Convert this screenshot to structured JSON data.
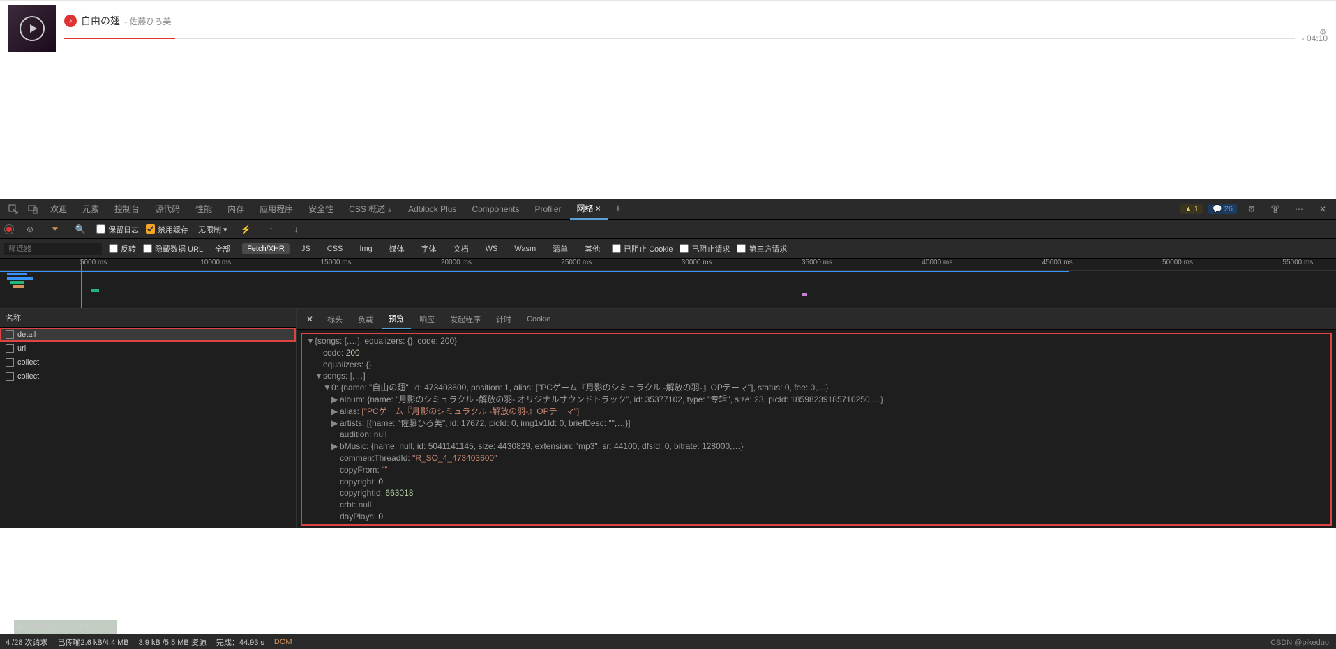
{
  "player": {
    "title": "自由の翅",
    "artist_prefix": "- ",
    "artist": "佐藤ひろ美",
    "duration_prefix": "- ",
    "duration": "04:10"
  },
  "devtools": {
    "tabs": [
      "欢迎",
      "元素",
      "控制台",
      "源代码",
      "性能",
      "内存",
      "应用程序",
      "安全性",
      "CSS 概述",
      "Adblock Plus",
      "Components",
      "Profiler",
      "网络"
    ],
    "active_tab": "网络",
    "warn_count": "1",
    "info_count": "26",
    "toolbar": {
      "preserve_log": "保留日志",
      "disable_cache": "禁用缓存",
      "throttle": "无限制"
    },
    "filter": {
      "placeholder": "筛选器",
      "invert": "反转",
      "hide_data_urls": "隐藏数据 URL",
      "all": "全部",
      "types": [
        "Fetch/XHR",
        "JS",
        "CSS",
        "Img",
        "媒体",
        "字体",
        "文档",
        "WS",
        "Wasm",
        "清单",
        "其他"
      ],
      "blocked_cookies": "已阻止 Cookie",
      "blocked_requests": "已阻止请求",
      "third_party": "第三方请求"
    },
    "timeline_ticks": [
      "5000 ms",
      "10000 ms",
      "15000 ms",
      "20000 ms",
      "25000 ms",
      "30000 ms",
      "35000 ms",
      "40000 ms",
      "45000 ms",
      "50000 ms",
      "55000 ms"
    ],
    "request_list": {
      "header": "名称",
      "items": [
        "detail",
        "url",
        "collect",
        "collect"
      ]
    },
    "detail_tabs": [
      "标头",
      "负载",
      "预览",
      "响应",
      "发起程序",
      "计时",
      "Cookie"
    ],
    "active_detail_tab": "预览",
    "json": {
      "root_summary": "{songs: [,…], equalizers: {}, code: 200}",
      "code_k": "code:",
      "code_v": "200",
      "equalizers_k": "equalizers:",
      "equalizers_v": "{}",
      "songs_k": "songs:",
      "songs_v": "[,…]",
      "song0_k": "0:",
      "song0_v": "{name: \"自由の翅\", id: 473403600, position: 1, alias: [\"PCゲーム『月影のシミュラクル -解放の羽-』OPテーマ\"], status: 0, fee: 0,…}",
      "album_k": "album:",
      "album_v": "{name: \"月影のシミュラクル -解放の羽- オリジナルサウンドトラック\", id: 35377102, type: \"专辑\", size: 23, picId: 18598239185710250,…}",
      "alias_k": "alias:",
      "alias_v": "[\"PCゲーム『月影のシミュラクル -解放の羽-』OPテーマ\"]",
      "artists_k": "artists:",
      "artists_v": "[{name: \"佐藤ひろ美\", id: 17672, picId: 0, img1v1Id: 0, briefDesc: \"\",…}]",
      "audition_k": "audition:",
      "audition_v": "null",
      "bmusic_k": "bMusic:",
      "bmusic_v": "{name: null, id: 5041141145, size: 4430829, extension: \"mp3\", sr: 44100, dfsId: 0, bitrate: 128000,…}",
      "commentthread_k": "commentThreadId:",
      "commentthread_v": "\"R_SO_4_473403600\"",
      "copyfrom_k": "copyFrom:",
      "copyfrom_v": "\"\"",
      "copyright_k": "copyright:",
      "copyright_v": "0",
      "copyrightid_k": "copyrightId:",
      "copyrightid_v": "663018",
      "crbt_k": "crbt:",
      "crbt_v": "null",
      "dayplays_k": "dayPlays:",
      "dayplays_v": "0"
    },
    "status_bar": {
      "requests": "4 /28 次请求",
      "transfer": "已传输2.6 kB/4.4 MB",
      "resources": "3.9 kB /5.5 MB 资源",
      "finish": "完成：44.93 s",
      "dom": "DOM"
    },
    "download_hint": "▶ 从该页面下载 音频 ① 2 ×",
    "watermark": "CSDN @pikeduo"
  }
}
